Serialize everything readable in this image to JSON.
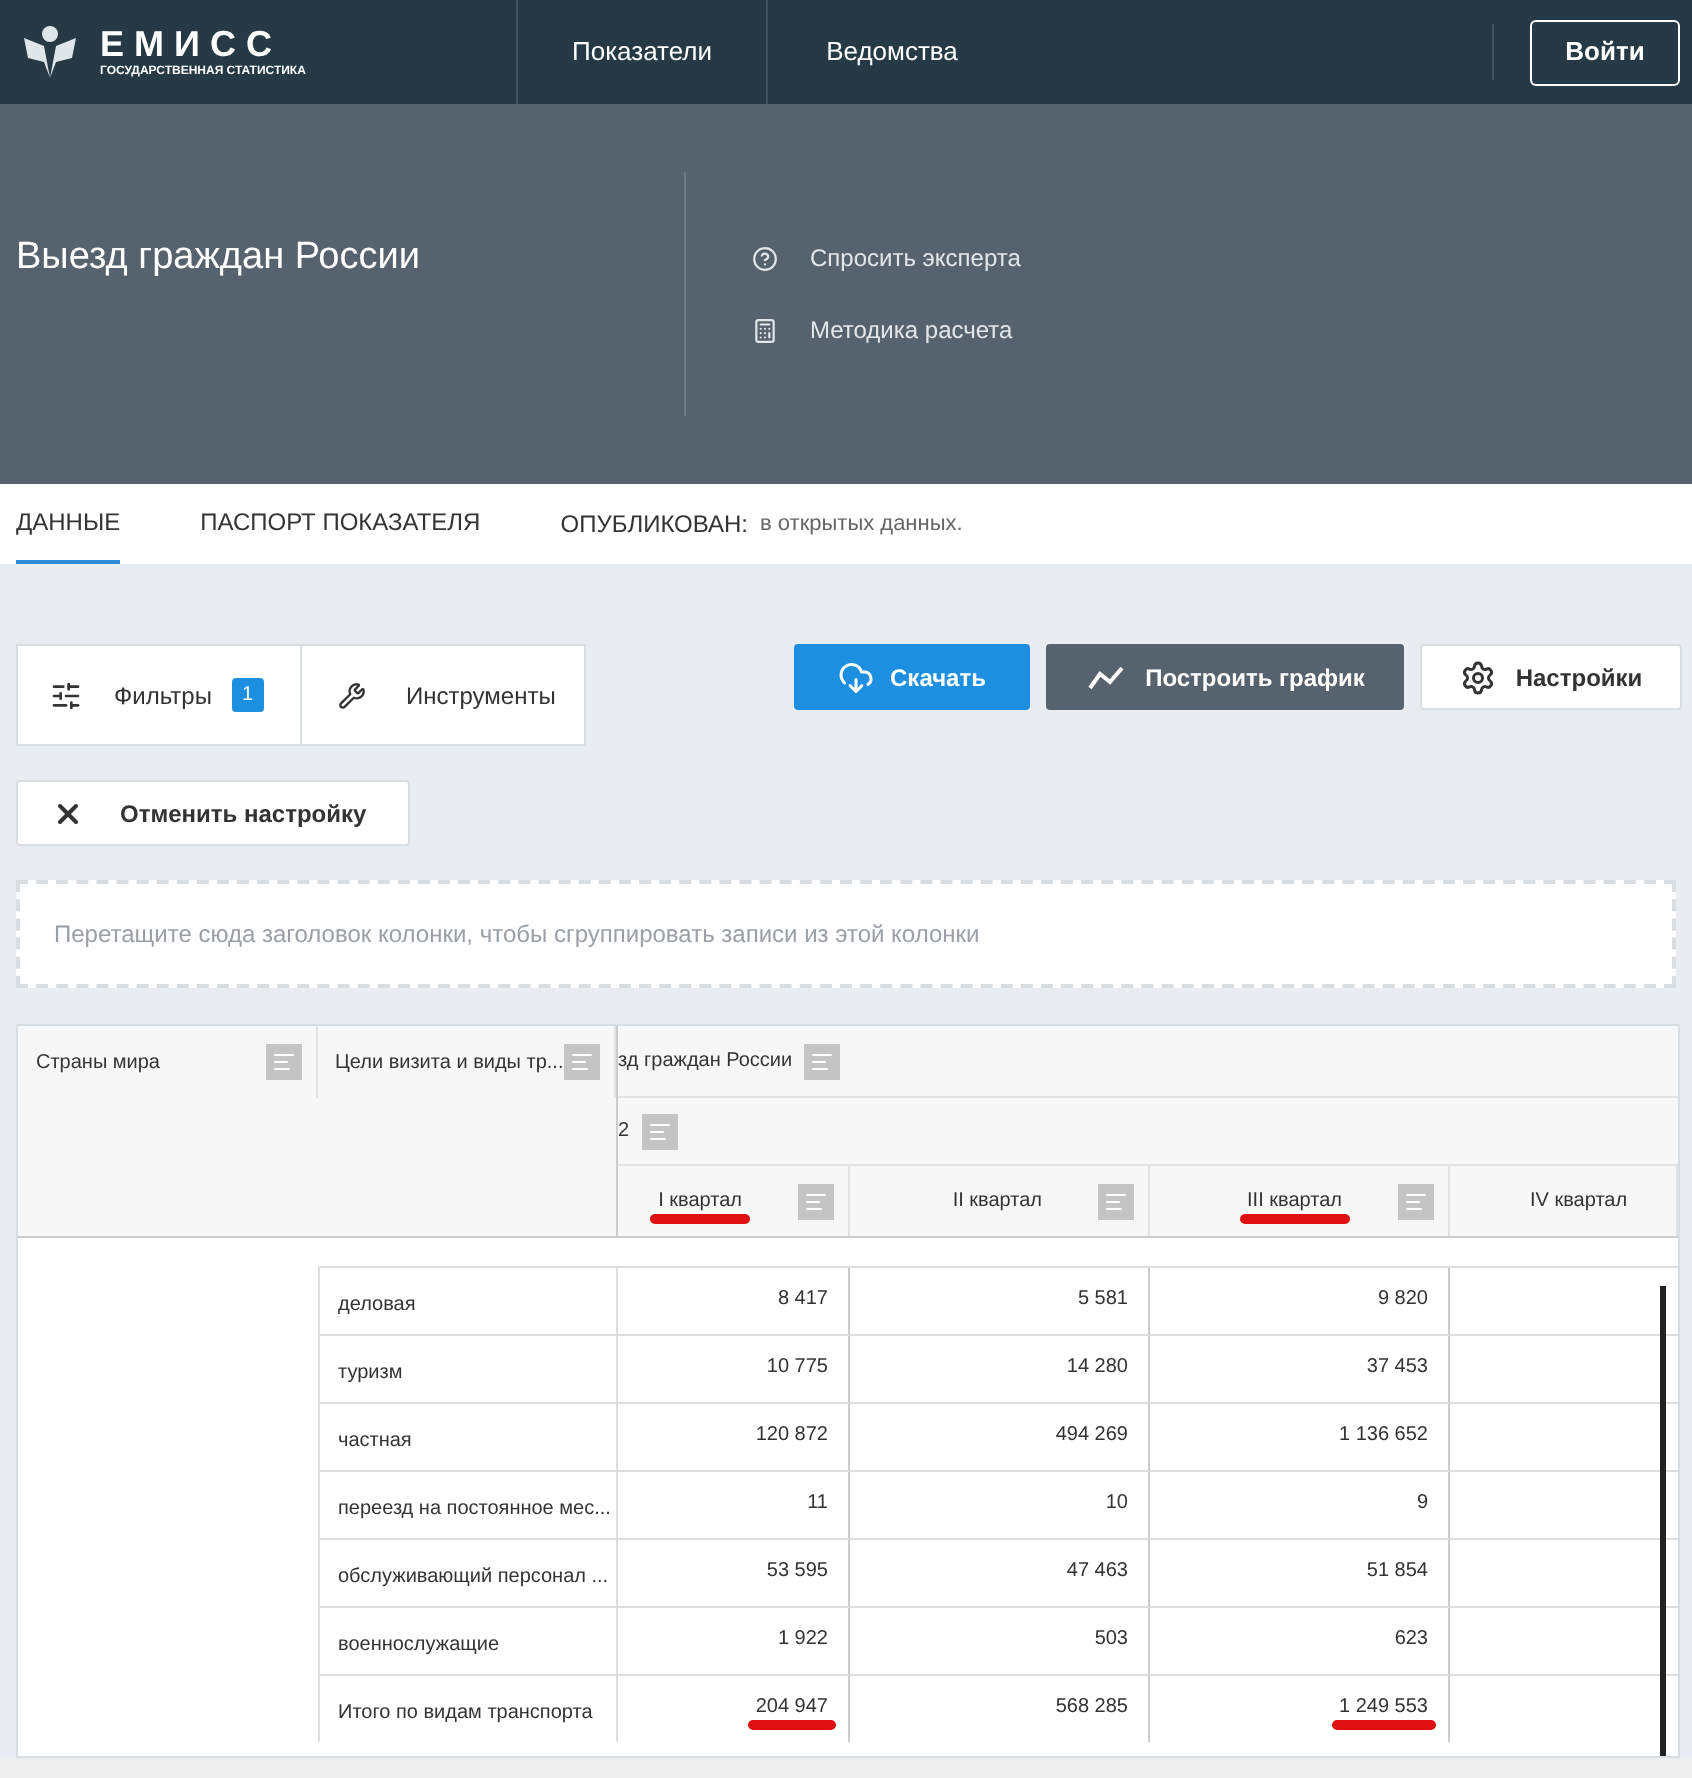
{
  "header": {
    "logo_title": "Е М И С С",
    "logo_subtitle": "ГОСУДАРСТВЕННАЯ СТАТИСТИКА",
    "nav": [
      "Показатели",
      "Ведомства"
    ],
    "login": "Войти"
  },
  "hero": {
    "title": "Выезд граждан России",
    "links": [
      {
        "kind": "help",
        "label": "Спросить эксперта"
      },
      {
        "kind": "calc",
        "label": "Методика расчета"
      }
    ]
  },
  "tabs": [
    {
      "label": "ДАННЫЕ",
      "selected": true
    },
    {
      "label": "ПАСПОРТ ПОКАЗАТЕЛЯ",
      "selected": false
    }
  ],
  "published": {
    "label": "ОПУБЛИКОВАН:",
    "value": "в открытых данных."
  },
  "toolbar": {
    "filters": {
      "label": "Фильтры",
      "count": "1"
    },
    "tools": "Инструменты",
    "download": "Скачать",
    "chart": "Построить график",
    "settings": "Настройки",
    "reset": "Отменить настройку"
  },
  "group_zone": {
    "placeholder": "Перетащите сюда заголовок колонки, чтобы сгруппировать записи из этой колонки"
  },
  "table": {
    "frozen_columns": [
      "Страны мира",
      "Цели визита и виды тр..."
    ],
    "group_header": "зд граждан России",
    "subgroup_header": "2",
    "columns": [
      {
        "label": "I квартал",
        "underlined": true
      },
      {
        "label": "II квартал",
        "underlined": false
      },
      {
        "label": "III квартал",
        "underlined": true
      },
      {
        "label": "IV квартал",
        "underlined": false
      }
    ],
    "rows": [
      {
        "label": "деловая",
        "values": [
          {
            "text": "8 417",
            "underlined": false
          },
          {
            "text": "5 581",
            "underlined": false
          },
          {
            "text": "9 820",
            "underlined": false
          }
        ]
      },
      {
        "label": "туризм",
        "values": [
          {
            "text": "10 775",
            "underlined": false
          },
          {
            "text": "14 280",
            "underlined": false
          },
          {
            "text": "37 453",
            "underlined": false
          }
        ]
      },
      {
        "label": "частная",
        "values": [
          {
            "text": "120 872",
            "underlined": false
          },
          {
            "text": "494 269",
            "underlined": false
          },
          {
            "text": "1 136 652",
            "underlined": false
          }
        ]
      },
      {
        "label": "переезд на постоянное мес...",
        "values": [
          {
            "text": "11",
            "underlined": false
          },
          {
            "text": "10",
            "underlined": false
          },
          {
            "text": "9",
            "underlined": false
          }
        ]
      },
      {
        "label": "обслуживающий персонал ...",
        "values": [
          {
            "text": "53 595",
            "underlined": false
          },
          {
            "text": "47 463",
            "underlined": false
          },
          {
            "text": "51 854",
            "underlined": false
          }
        ]
      },
      {
        "label": "военнослужащие",
        "values": [
          {
            "text": "1 922",
            "underlined": false
          },
          {
            "text": "503",
            "underlined": false
          },
          {
            "text": "623",
            "underlined": false
          }
        ]
      },
      {
        "label": "Итого по видам транспорта",
        "values": [
          {
            "text": "204 947",
            "underlined": true
          },
          {
            "text": "568 285",
            "underlined": false
          },
          {
            "text": "1 249 553",
            "underlined": true
          }
        ]
      }
    ]
  }
}
